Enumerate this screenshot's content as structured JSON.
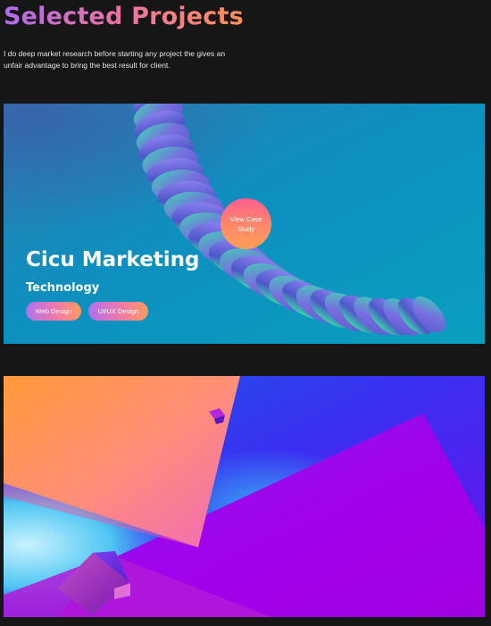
{
  "section": {
    "title": "Selected Projects",
    "description": "I do deep market research before starting any project the gives an unfair advantage to bring the best result for client."
  },
  "projects": [
    {
      "name": "Cicu Marketing",
      "category": "Technology",
      "cta_label": "View Case Study",
      "tags": [
        "Web Design",
        "UI/UX Design"
      ],
      "image": "3d-spiral-ribbon-artwork"
    },
    {
      "image": "3d-geometric-planes-artwork"
    }
  ],
  "colors": {
    "background": "#171616",
    "accent_gradient": [
      "#b06bf0",
      "#e872a8",
      "#ff8f5a"
    ],
    "card1_base": "#1389b8",
    "card2_base": "#8a10ee"
  }
}
